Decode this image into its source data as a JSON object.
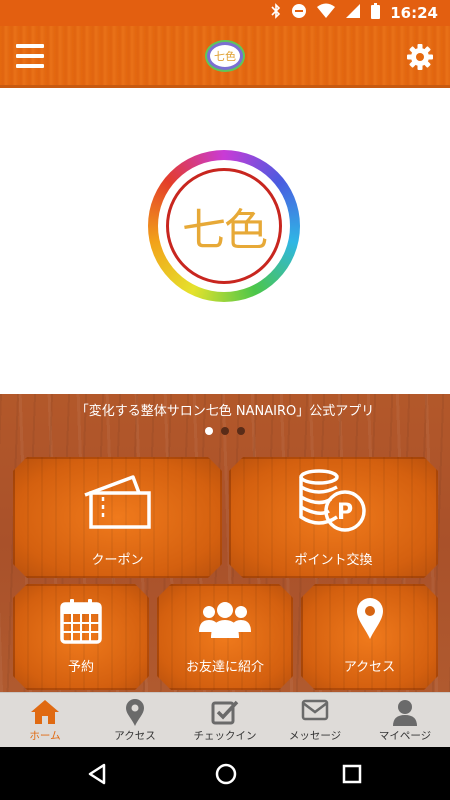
{
  "status_bar": {
    "time": "16:24",
    "icons": [
      "bluetooth-icon",
      "dnd-icon",
      "wifi-icon",
      "signal-icon",
      "battery-icon"
    ]
  },
  "app_bar": {
    "logo_text": "七色",
    "menu_icon": "hamburger-icon",
    "settings_icon": "gear-icon"
  },
  "banner": {
    "logo_text": "七色"
  },
  "carousel": {
    "tagline": "「変化する整体サロン七色 NANAIRO」公式アプリ",
    "pages": 3,
    "active_page": 1
  },
  "tiles": {
    "coupon": {
      "label": "クーポン",
      "icon": "ticket-icon"
    },
    "points": {
      "label": "ポイント交換",
      "icon": "coins-p-icon"
    },
    "reserve": {
      "label": "予約",
      "icon": "calendar-icon"
    },
    "invite": {
      "label": "お友達に紹介",
      "icon": "group-icon"
    },
    "access": {
      "label": "アクセス",
      "icon": "map-pin-icon"
    }
  },
  "bottom_nav": [
    {
      "label": "ホーム",
      "icon": "home-icon",
      "active": true
    },
    {
      "label": "アクセス",
      "icon": "map-pin-icon",
      "active": false
    },
    {
      "label": "チェックイン",
      "icon": "checkbox-icon",
      "active": false
    },
    {
      "label": "メッセージ",
      "icon": "envelope-icon",
      "active": false
    },
    {
      "label": "マイページ",
      "icon": "person-icon",
      "active": false
    }
  ],
  "colors": {
    "accent": "#E5690F",
    "active_nav": "#E06A12",
    "wood": "#A9512A",
    "logo_gold": "#E7A937",
    "logo_red": "#C8261F"
  }
}
